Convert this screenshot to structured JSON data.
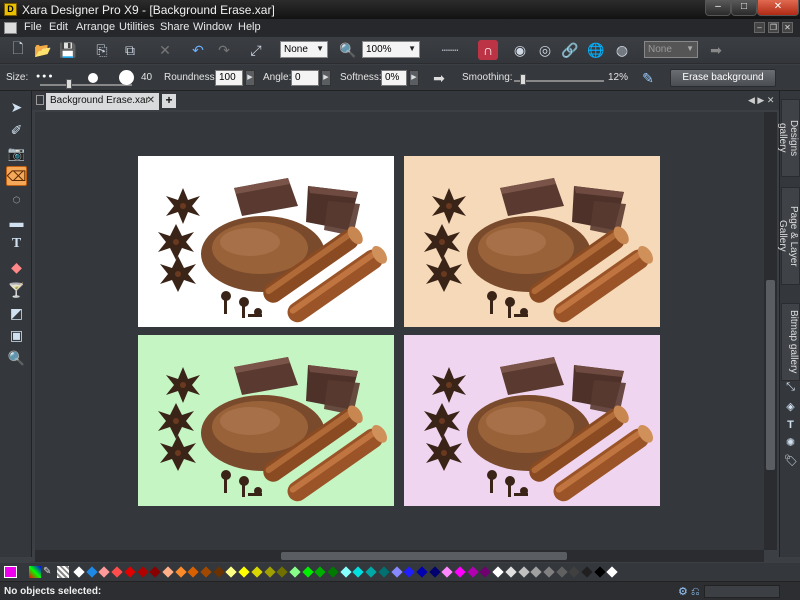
{
  "app": {
    "title": "Xara Designer Pro X9 - [Background Erase.xar]",
    "logo": "D"
  },
  "window_controls": {
    "minimize": "–",
    "maximize": "□",
    "close": "✕"
  },
  "menu": [
    "File",
    "Edit",
    "Arrange",
    "Utilities",
    "Share",
    "Window",
    "Help"
  ],
  "doc_controls": {
    "minimize": "–",
    "restore": "❐",
    "close": "✕"
  },
  "toolbar": {
    "quality_value": "None",
    "zoom_value": "100%",
    "page_select_value": "None"
  },
  "infobar": {
    "size_label": "Size:",
    "size_value": "40",
    "roundness_label": "Roundness:",
    "roundness_value": "100",
    "angle_label": "Angle:",
    "angle_value": "0",
    "softness_label": "Softness:",
    "softness_value": "0%",
    "smoothing_label": "Smoothing:",
    "smoothing_value": "12%",
    "erase_button": "Erase background"
  },
  "tab": {
    "label": "Background Erase.xar",
    "close": "✕",
    "add": "+"
  },
  "panel_tabs": [
    "Designs gallery",
    "Page & Layer Gallery",
    "Bitmap gallery"
  ],
  "photos": {
    "backgrounds": [
      "#ffffff",
      "#f5d9b8",
      "#c6f5c4",
      "#f0d5f0"
    ]
  },
  "palette": {
    "colors": [
      "#ffffff",
      "#1e88e5",
      "#ff9a9a",
      "#ff4d4d",
      "#e00000",
      "#b00000",
      "#880000",
      "#ffb088",
      "#ff8a2a",
      "#d86000",
      "#a04800",
      "#6a3200",
      "#ffff88",
      "#ffff00",
      "#d8d800",
      "#a0a000",
      "#707000",
      "#88ff88",
      "#00ee00",
      "#00b000",
      "#007a00",
      "#88ffff",
      "#00e0e0",
      "#00a8a8",
      "#007070",
      "#8888ff",
      "#2020ff",
      "#0000b0",
      "#000070",
      "#ff88ff",
      "#ff00ff",
      "#b000b0",
      "#700070",
      "#ffffff",
      "#e0e0e0",
      "#c0c0c0",
      "#a0a0a0",
      "#808080",
      "#606060",
      "#404040",
      "#202020",
      "#000000",
      "#ffffff"
    ]
  },
  "status": {
    "text": "No objects selected:"
  }
}
